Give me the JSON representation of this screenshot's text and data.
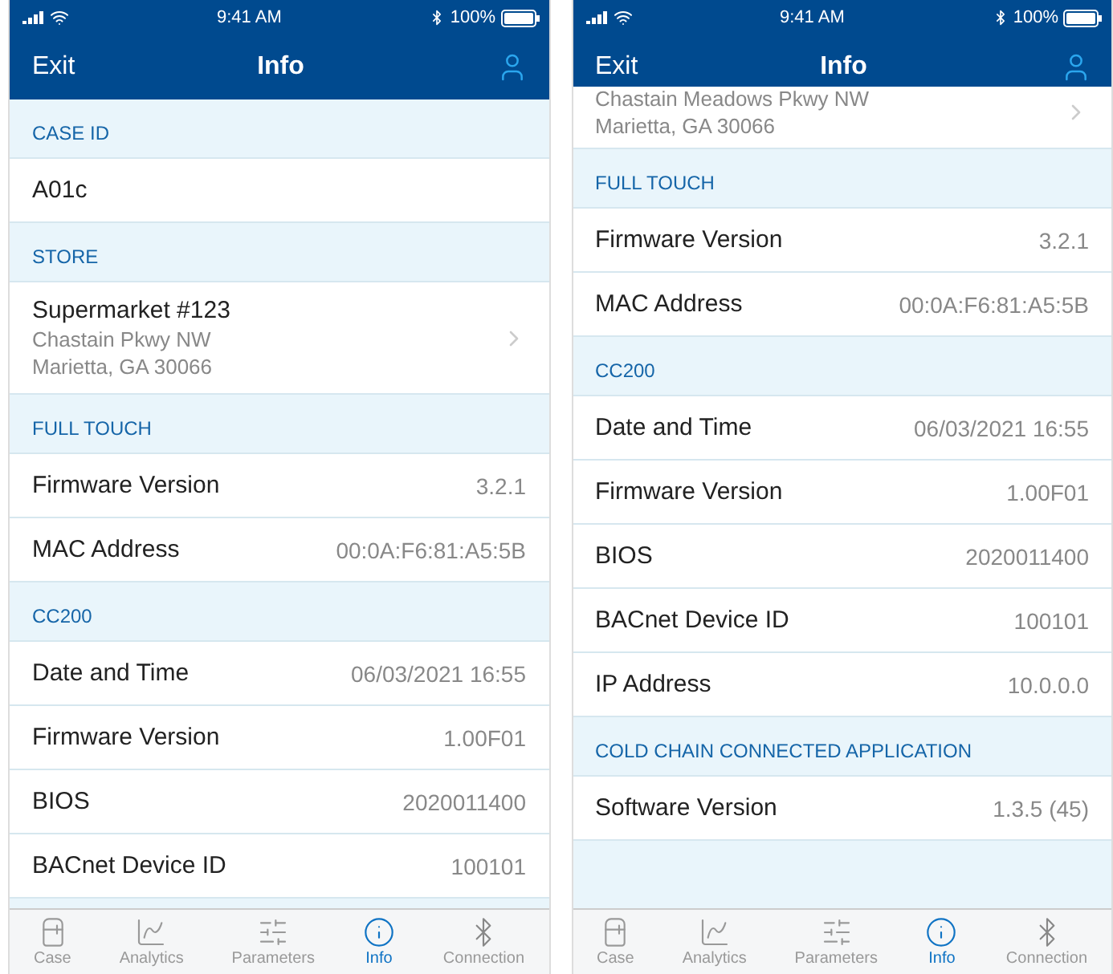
{
  "screens": [
    {
      "status_bar": {
        "time": "9:41 AM",
        "battery": "100%"
      },
      "nav": {
        "left": "Exit",
        "title": "Info"
      },
      "sections": [
        {
          "header": "CASE ID",
          "rows": [
            {
              "kind": "text",
              "value": "A01c"
            }
          ]
        },
        {
          "header": "STORE",
          "rows": [
            {
              "kind": "store",
              "title": "Supermarket #123",
              "lines": [
                "Chastain Pkwy NW",
                "Marietta, GA 30066"
              ]
            }
          ]
        },
        {
          "header": "FULL TOUCH",
          "rows": [
            {
              "kind": "pair",
              "label": "Firmware Version",
              "value": "3.2.1"
            },
            {
              "kind": "pair",
              "label": "MAC Address",
              "value": "00:0A:F6:81:A5:5B"
            }
          ]
        },
        {
          "header": "CC200",
          "rows": [
            {
              "kind": "pair",
              "label": "Date and Time",
              "value": "06/03/2021 16:55"
            },
            {
              "kind": "pair",
              "label": "Firmware Version",
              "value": "1.00F01"
            },
            {
              "kind": "pair",
              "label": "BIOS",
              "value": "2020011400"
            },
            {
              "kind": "pair",
              "label": "BACnet Device ID",
              "value": "100101"
            }
          ]
        }
      ],
      "tabs": [
        {
          "label": "Case",
          "selected": false
        },
        {
          "label": "Analytics",
          "selected": false
        },
        {
          "label": "Parameters",
          "selected": false
        },
        {
          "label": "Info",
          "selected": true
        },
        {
          "label": "Connection",
          "selected": false
        }
      ]
    },
    {
      "status_bar": {
        "time": "9:41 AM",
        "battery": "100%"
      },
      "nav": {
        "left": "Exit",
        "title": "Info"
      },
      "sections": [
        {
          "rows": [
            {
              "kind": "store",
              "lines": [
                "Chastain Meadows Pkwy NW",
                "Marietta, GA 30066"
              ]
            }
          ]
        },
        {
          "header": "FULL TOUCH",
          "rows": [
            {
              "kind": "pair",
              "label": "Firmware Version",
              "value": "3.2.1"
            },
            {
              "kind": "pair",
              "label": "MAC Address",
              "value": "00:0A:F6:81:A5:5B"
            }
          ]
        },
        {
          "header": "CC200",
          "rows": [
            {
              "kind": "pair",
              "label": "Date and Time",
              "value": "06/03/2021 16:55"
            },
            {
              "kind": "pair",
              "label": "Firmware Version",
              "value": "1.00F01"
            },
            {
              "kind": "pair",
              "label": "BIOS",
              "value": "2020011400"
            },
            {
              "kind": "pair",
              "label": "BACnet Device ID",
              "value": "100101"
            },
            {
              "kind": "pair",
              "label": "IP Address",
              "value": "10.0.0.0"
            }
          ]
        },
        {
          "header": "COLD CHAIN CONNECTED APPLICATION",
          "rows": [
            {
              "kind": "pair",
              "label": "Software Version",
              "value": "1.3.5 (45)"
            }
          ]
        }
      ],
      "tabs": [
        {
          "label": "Case",
          "selected": false
        },
        {
          "label": "Analytics",
          "selected": false
        },
        {
          "label": "Parameters",
          "selected": false
        },
        {
          "label": "Info",
          "selected": true
        },
        {
          "label": "Connection",
          "selected": false
        }
      ]
    }
  ]
}
